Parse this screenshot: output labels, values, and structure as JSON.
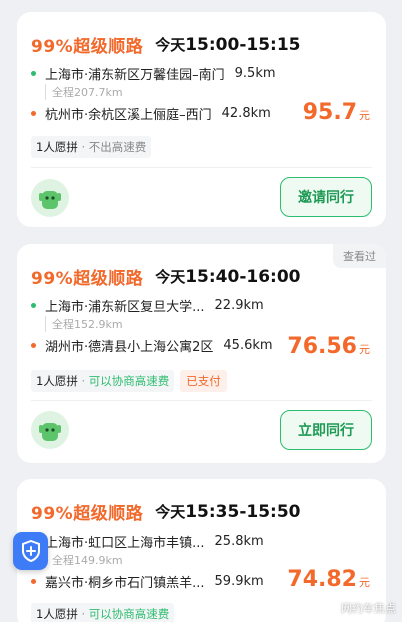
{
  "cards": [
    {
      "match": "99%超级顺路",
      "day": "今天",
      "time": "15:00-15:15",
      "start": "上海市·浦东新区万馨佳园–南门",
      "start_dist": "9.5km",
      "total": "全程207.7km",
      "end": "杭州市·余杭区溪上俪庭–西门",
      "end_dist": "42.8km",
      "price": "95.7",
      "unit": "元",
      "tag_seats": "1人愿拼",
      "tag_highway": "不出高速费",
      "tag_paid": "",
      "viewed": "",
      "action": "邀请同行"
    },
    {
      "match": "99%超级顺路",
      "day": "今天",
      "time": "15:40-16:00",
      "start": "上海市·浦东新区复旦大学...",
      "start_dist": "22.9km",
      "total": "全程152.9km",
      "end": "湖州市·德清县小上海公寓2区",
      "end_dist": "45.6km",
      "price": "76.56",
      "unit": "元",
      "tag_seats": "1人愿拼",
      "tag_highway": "可以协商高速费",
      "tag_paid": "已支付",
      "viewed": "查看过",
      "action": "立即同行"
    },
    {
      "match": "99%超级顺路",
      "day": "今天",
      "time": "15:35-15:50",
      "start": "上海市·虹口区上海市丰镇...",
      "start_dist": "25.8km",
      "total": "全程149.9km",
      "end": "嘉兴市·桐乡市石门镇羔羊...",
      "end_dist": "59.9km",
      "price": "74.82",
      "unit": "元",
      "tag_seats": "1人愿拼",
      "tag_highway": "可以协商高速费",
      "tag_paid": "",
      "viewed": "",
      "action": ""
    }
  ],
  "separator": "·",
  "safety_icon": "shield-plus-icon",
  "watermark": "网约车焦点",
  "colors": {
    "accent": "#f2692b",
    "green": "#2dbd6e",
    "safety": "#3e7bf6"
  }
}
